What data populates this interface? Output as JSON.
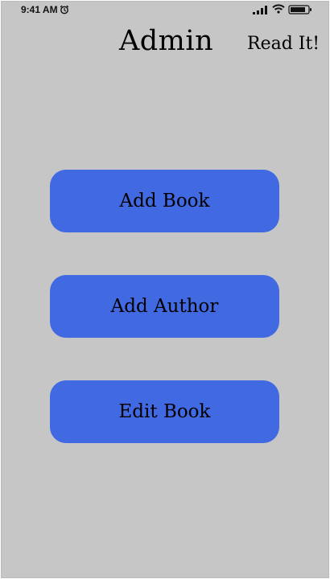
{
  "status_bar": {
    "time": "9:41 AM",
    "icons": [
      "alarm-icon",
      "signal-icon",
      "wifi-icon",
      "battery-icon"
    ]
  },
  "header": {
    "title": "Admin",
    "brand": "Read It!"
  },
  "actions": {
    "add_book": "Add Book",
    "add_author": "Add Author",
    "edit_book": "Edit Book"
  },
  "colors": {
    "background": "#c6c6c6",
    "button": "#4169e1",
    "text": "#000000"
  }
}
